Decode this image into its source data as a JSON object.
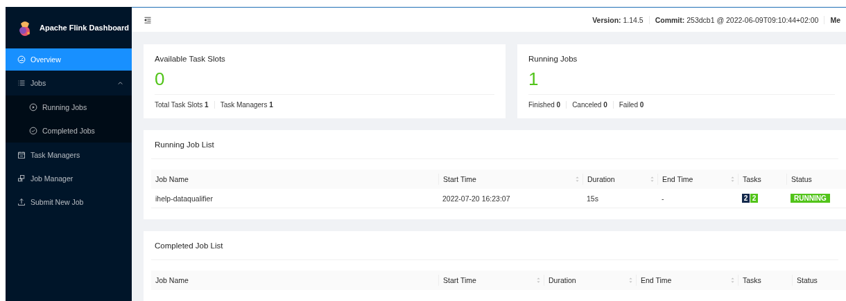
{
  "sidebar": {
    "title": "Apache Flink Dashboard",
    "items": [
      {
        "label": "Overview",
        "selected": true
      },
      {
        "label": "Jobs",
        "selected": false,
        "expanded": true,
        "children": [
          {
            "label": "Running Jobs",
            "selected": false
          },
          {
            "label": "Completed Jobs",
            "selected": false
          }
        ]
      },
      {
        "label": "Task Managers",
        "selected": false
      },
      {
        "label": "Job Manager",
        "selected": false
      },
      {
        "label": "Submit New Job",
        "selected": false
      }
    ]
  },
  "header": {
    "info": [
      {
        "label": "Version:",
        "value": "1.14.5"
      },
      {
        "label": "Commit:",
        "value": "253dcb1 @ 2022-06-09T09:10:44+02:00"
      },
      {
        "label": "Me"
      }
    ]
  },
  "cards": [
    {
      "title": "Available Task Slots",
      "value": "0",
      "stats": [
        {
          "label": "Total Task Slots",
          "value": "1"
        },
        {
          "label": "Task Managers",
          "value": "1"
        }
      ]
    },
    {
      "title": "Running Jobs",
      "value": "1",
      "stats": [
        {
          "label": "Finished",
          "value": "0"
        },
        {
          "label": "Canceled",
          "value": "0"
        },
        {
          "label": "Failed",
          "value": "0"
        }
      ]
    }
  ],
  "lists": [
    {
      "title": "Running Job List",
      "columns": [
        {
          "label": "Job Name",
          "sortable": false
        },
        {
          "label": "Start Time",
          "sortable": true
        },
        {
          "label": "Duration",
          "sortable": true
        },
        {
          "label": "End Time",
          "sortable": true
        },
        {
          "label": "Tasks",
          "sortable": false
        },
        {
          "label": "Status",
          "sortable": false
        }
      ],
      "rows": [
        {
          "job_name": "ihelp-dataqualifier",
          "start_time": "2022-07-20 16:23:07",
          "duration": "15s",
          "end_time": "-",
          "tasks": [
            {
              "count": "2",
              "color": "#13294b"
            },
            {
              "count": "2",
              "color": "#52c41a"
            }
          ],
          "status": {
            "label": "RUNNING",
            "color": "#52c41a"
          }
        }
      ]
    },
    {
      "title": "Completed Job List",
      "columns": [
        {
          "label": "Job Name",
          "sortable": false
        },
        {
          "label": "Start Time",
          "sortable": true
        },
        {
          "label": "Duration",
          "sortable": true
        },
        {
          "label": "End Time",
          "sortable": true
        },
        {
          "label": "Tasks",
          "sortable": false
        },
        {
          "label": "Status",
          "sortable": false
        }
      ]
    }
  ]
}
